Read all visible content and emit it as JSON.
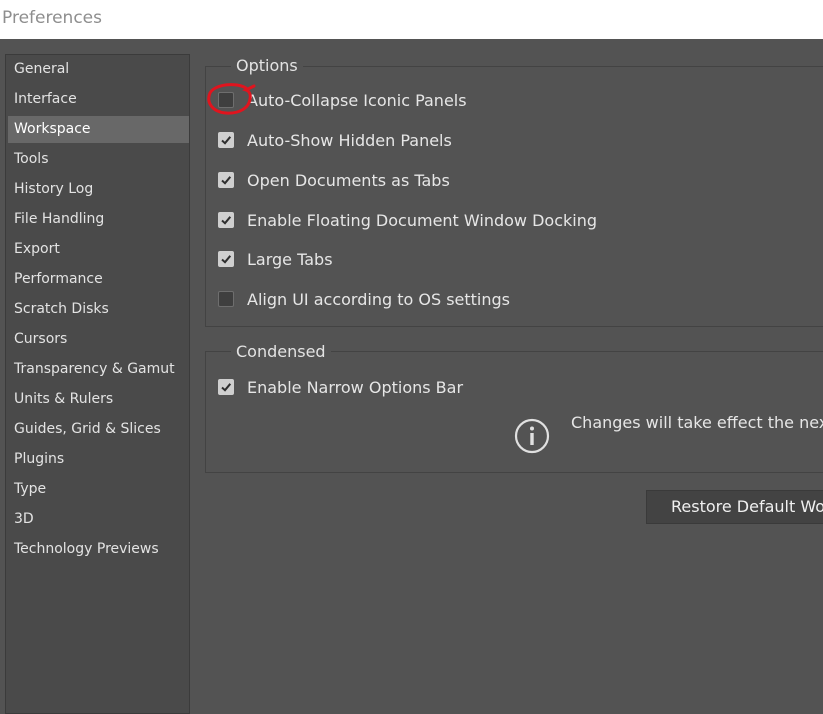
{
  "window": {
    "title": "Preferences"
  },
  "sidebar": {
    "items": [
      {
        "label": "General"
      },
      {
        "label": "Interface"
      },
      {
        "label": "Workspace",
        "selected": true
      },
      {
        "label": "Tools"
      },
      {
        "label": "History Log"
      },
      {
        "label": "File Handling"
      },
      {
        "label": "Export"
      },
      {
        "label": "Performance"
      },
      {
        "label": "Scratch Disks"
      },
      {
        "label": "Cursors"
      },
      {
        "label": "Transparency & Gamut"
      },
      {
        "label": "Units & Rulers"
      },
      {
        "label": "Guides, Grid & Slices"
      },
      {
        "label": "Plugins"
      },
      {
        "label": "Type"
      },
      {
        "label": "3D"
      },
      {
        "label": "Technology Previews"
      }
    ]
  },
  "options": {
    "title": "Options",
    "items": [
      {
        "label": "Auto-Collapse Iconic Panels",
        "checked": false
      },
      {
        "label": "Auto-Show Hidden Panels",
        "checked": true
      },
      {
        "label": "Open Documents as Tabs",
        "checked": true
      },
      {
        "label": "Enable Floating Document Window Docking",
        "checked": true
      },
      {
        "label": "Large Tabs",
        "checked": true
      },
      {
        "label": "Align UI according to OS settings",
        "checked": false
      }
    ]
  },
  "condensed": {
    "title": "Condensed",
    "items": [
      {
        "label": "Enable Narrow Options Bar",
        "checked": true
      }
    ],
    "notice": "Changes will take effect the nex"
  },
  "restore_button": {
    "label": "Restore Default Wo"
  },
  "colors": {
    "panel_bg": "#535353",
    "sidebar_bg": "#4a4a4a",
    "selected_bg": "#686868",
    "annotation_red": "#e0141e"
  },
  "icons": {
    "info": "info-circle-icon",
    "check": "checkmark-icon"
  }
}
